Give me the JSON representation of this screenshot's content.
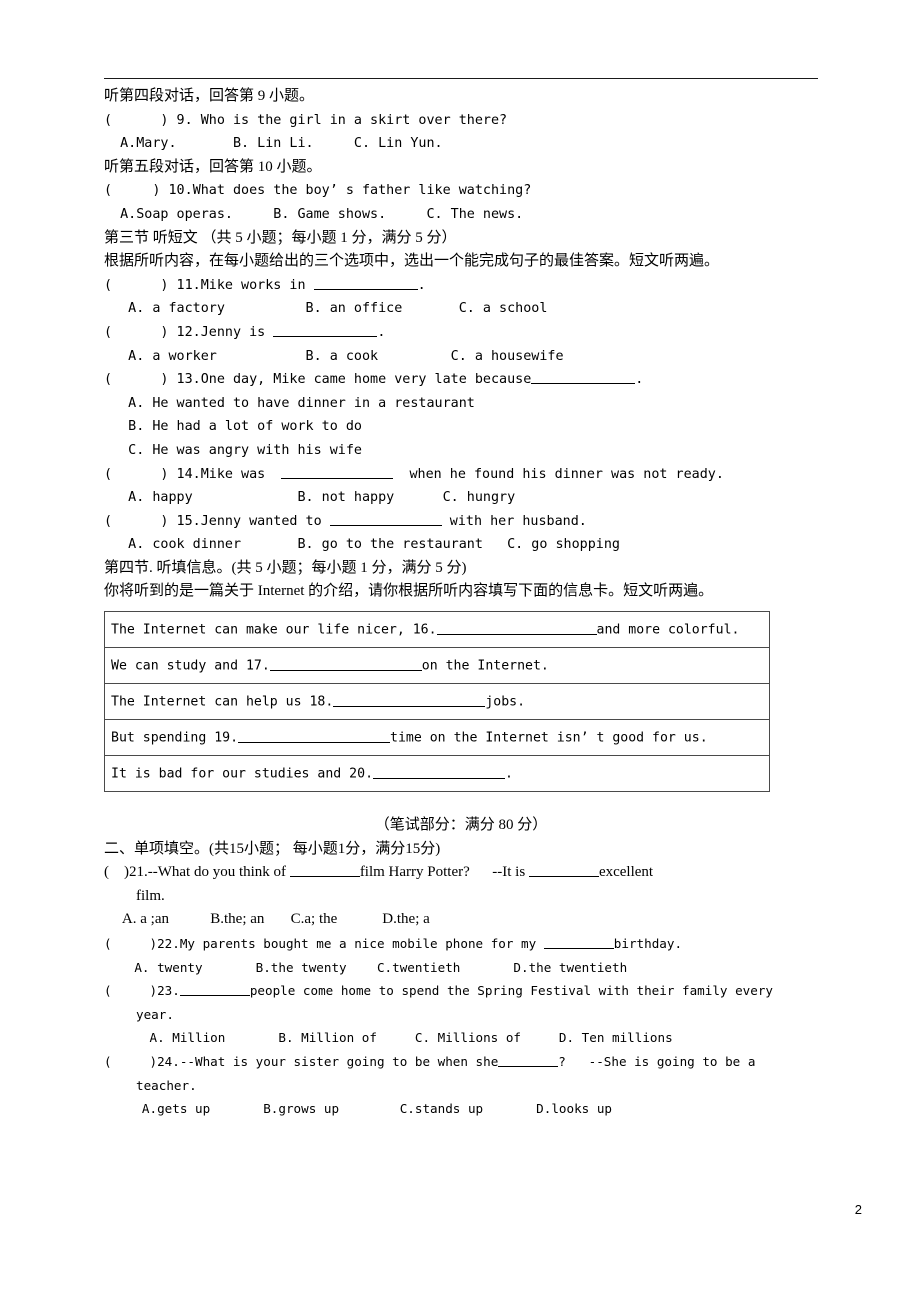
{
  "page": {
    "number": "2",
    "rule_present": true
  },
  "listening": {
    "dialog4_heading": "听第四段对话，回答第 9 小题。",
    "q9": {
      "marker": "(      ) 9. ",
      "stem": "Who is the girl in a skirt over there?",
      "options": "  A.Mary.       B. Lin Li.     C. Lin Yun."
    },
    "dialog5_heading": "听第五段对话，回答第 10 小题。",
    "q10": {
      "marker": "(     ) 10.",
      "stem": "What does the boy’ s father like watching?",
      "options": "  A.Soap operas.     B. Game shows.     C. The news."
    }
  },
  "section3": {
    "heading": "第三节 听短文 （共 5 小题；每小题 1 分，满分 5 分）",
    "instruction": "根据所听内容，在每小题给出的三个选项中，选出一个能完成句子的最佳答案。短文听两遍。",
    "questions": [
      {
        "marker": "(      ) 11.",
        "stem_before": "Mike works in ",
        "stem_after": ".",
        "options": "   A. a factory          B. an office       C. a school"
      },
      {
        "marker": "(      ) 12.",
        "stem_before": "Jenny is ",
        "stem_after": ".",
        "options": "   A. a worker           B. a cook         C. a housewife"
      },
      {
        "marker": "(      ) 13.",
        "stem_before": "One day, Mike came home very late because",
        "stem_after": ".",
        "options_multi": [
          "   A. He wanted to have dinner in a restaurant",
          "   B. He had a lot of work to do",
          "   C. He was angry with his wife"
        ]
      },
      {
        "marker": "(      ) 14.",
        "stem_before": "Mike was  ",
        "stem_after": "  when he found his dinner was not ready.",
        "options": "   A. happy             B. not happy      C. hungry"
      },
      {
        "marker": "(      ) 15.",
        "stem_before": "Jenny wanted to ",
        "stem_after": " with her husband.",
        "options": "   A. cook dinner       B. go to the restaurant   C. go shopping"
      }
    ]
  },
  "section4": {
    "heading": "第四节. 听填信息。(共 5 小题；每小题 1 分，满分 5 分)",
    "instruction": "你将听到的是一篇关于 Internet 的介绍，请你根据所听内容填写下面的信息卡。短文听两遍。",
    "rows": [
      {
        "before": "The Internet can make our life nicer, 16.",
        "after": "and more colorful.",
        "blank": "b-160"
      },
      {
        "before": "We can study and 17.",
        "after": "on the Internet.",
        "blank": "b-150"
      },
      {
        "before": "The Internet can help us 18.",
        "after": "jobs.",
        "blank": "b-150"
      },
      {
        "before": "But spending 19.",
        "after": "time on the Internet isn’ t good for us.",
        "blank": "b-150"
      },
      {
        "before": "It is bad for our studies and 20.",
        "after": ".",
        "blank": "b-130"
      }
    ]
  },
  "written": {
    "part_heading": "（笔试部分：满分 80 分）",
    "section_heading": "二、单项填空。(共15小题； 每小题1分，满分15分)",
    "questions": [
      {
        "marker": "(    )21.",
        "stem_a": "--What do you think of ",
        "stem_b": "film Harry Potter?      --It is ",
        "stem_c": "excellent",
        "wrap": "film.",
        "options": "     A. a ;an           B.the; an       C.a; the            D.the; a"
      },
      {
        "marker": "(     )22.",
        "stem_a": "My parents bought me a nice mobile phone for my ",
        "stem_c": "birthday.",
        "options": "    A. twenty       B.the twenty    C.twentieth       D.the twentieth"
      },
      {
        "marker": "(     )23.",
        "stem_a": "",
        "stem_c": "people come home to spend the Spring Festival with their family every",
        "wrap": "year.",
        "options": "      A. Million       B. Million of     C. Millions of     D. Ten millions"
      },
      {
        "marker": "(     )24.",
        "stem_a": "--What is your sister going to be when she",
        "stem_c": "?   --She is going to be a",
        "wrap": "teacher.",
        "options": "     A.gets up       B.grows up        C.stands up       D.looks up"
      }
    ]
  }
}
